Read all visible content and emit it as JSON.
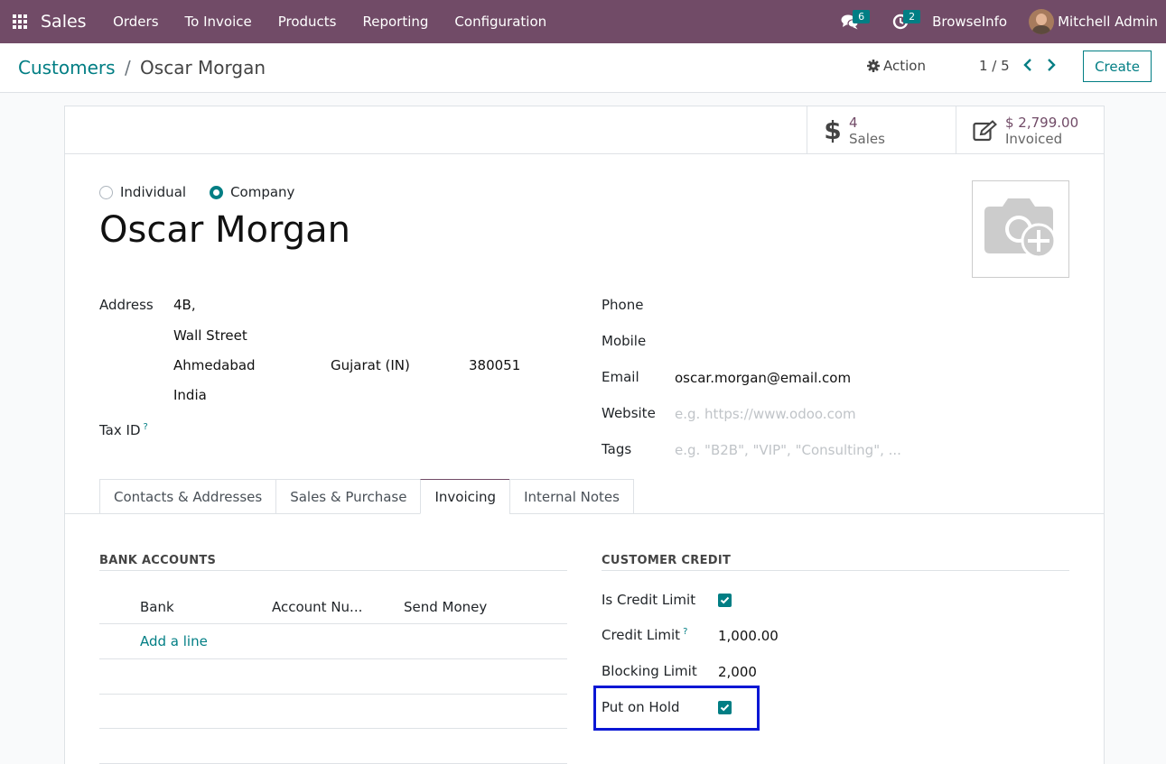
{
  "navbar": {
    "app_name": "Sales",
    "menu": [
      "Orders",
      "To Invoice",
      "Products",
      "Reporting",
      "Configuration"
    ],
    "messages_count": "6",
    "activities_count": "2",
    "browse_info": "BrowseInfo",
    "user_name": "Mitchell Admin"
  },
  "breadcrumb": {
    "parent": "Customers",
    "separator": "/",
    "current": "Oscar Morgan"
  },
  "controls": {
    "action_label": "Action",
    "pager": "1 / 5",
    "create_label": "Create"
  },
  "stat_buttons": {
    "sales": {
      "value": "4",
      "label": "Sales"
    },
    "invoiced": {
      "value": "$ 2,799.00",
      "label": "Invoiced"
    }
  },
  "company_type": {
    "options": [
      "Individual",
      "Company"
    ],
    "selected": "Company"
  },
  "partner_name": "Oscar Morgan",
  "address": {
    "label": "Address",
    "street": "4B,",
    "street2": "Wall Street",
    "city": "Ahmedabad",
    "state": "Gujarat (IN)",
    "zip": "380051",
    "country": "India"
  },
  "tax_id_label": "Tax ID",
  "help_mark": "?",
  "contact": {
    "phone_label": "Phone",
    "mobile_label": "Mobile",
    "email_label": "Email",
    "email": "oscar.morgan@email.com",
    "website_label": "Website",
    "website_placeholder": "e.g. https://www.odoo.com",
    "tags_label": "Tags",
    "tags_placeholder": "e.g. \"B2B\", \"VIP\", \"Consulting\", ..."
  },
  "tabs": [
    "Contacts & Addresses",
    "Sales & Purchase",
    "Invoicing",
    "Internal Notes"
  ],
  "active_tab": "Invoicing",
  "bank_accounts": {
    "title": "BANK ACCOUNTS",
    "columns": [
      "Bank",
      "Account Nu...",
      "Send Money"
    ],
    "add_line": "Add a line"
  },
  "customer_credit": {
    "title": "CUSTOMER CREDIT",
    "is_credit_limit_label": "Is Credit Limit",
    "is_credit_limit": true,
    "credit_limit_label": "Credit Limit",
    "credit_limit": "1,000.00",
    "blocking_limit_label": "Blocking Limit",
    "blocking_limit": "2,000",
    "put_on_hold_label": "Put on Hold",
    "put_on_hold": true
  },
  "colors": {
    "brand": "#714b67",
    "accent": "#017e84",
    "highlight": "#0a17d4"
  }
}
